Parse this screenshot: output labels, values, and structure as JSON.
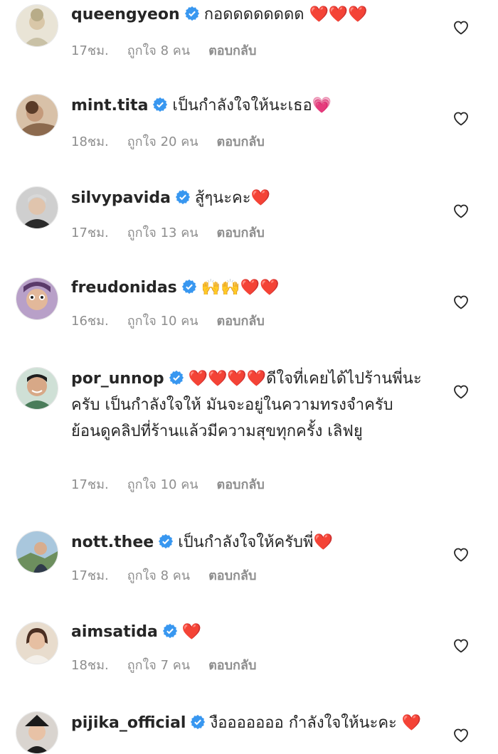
{
  "comments": [
    {
      "username": "queengyeon",
      "text": "กอดดดดดดดด ❤️❤️❤️",
      "time": "17ชม.",
      "likes": "ถูกใจ 8 คน",
      "reply": "ตอบกลับ"
    },
    {
      "username": "mint.tita",
      "text": "เป็นกำลังใจให้นะเธอ💗",
      "time": "18ชม.",
      "likes": "ถูกใจ 20 คน",
      "reply": "ตอบกลับ"
    },
    {
      "username": "silvypavida",
      "text": "สู้ๆนะคะ❤️",
      "time": "17ชม.",
      "likes": "ถูกใจ 13 คน",
      "reply": "ตอบกลับ"
    },
    {
      "username": "freudonidas",
      "text": "🙌🙌❤️❤️",
      "time": "16ชม.",
      "likes": "ถูกใจ 10 คน",
      "reply": "ตอบกลับ"
    },
    {
      "username": "por_unnop",
      "text": "❤️❤️❤️❤️ดีใจที่เคยได้ไปร้านพี่นะครับ เป็นกำลังใจให้ มันจะอยู่ในความทรงจำครับ ย้อนดูคลิปที่ร้านแล้วมีความสุขทุกครั้ง เลิฟยู",
      "time": "17ชม.",
      "likes": "ถูกใจ 10 คน",
      "reply": "ตอบกลับ"
    },
    {
      "username": "nott.thee",
      "text": "เป็นกำลังใจให้ครับพี่❤️",
      "time": "17ชม.",
      "likes": "ถูกใจ 8 คน",
      "reply": "ตอบกลับ"
    },
    {
      "username": "aimsatida",
      "text": "❤️",
      "time": "18ชม.",
      "likes": "ถูกใจ 7 คน",
      "reply": "ตอบกลับ"
    },
    {
      "username": "pijika_official",
      "text": "งือออออออ กำลังใจให้นะคะ ❤️",
      "time": "",
      "likes": "",
      "reply": ""
    }
  ],
  "icons": {
    "verified": "verified-badge-icon",
    "like": "heart-outline-icon"
  },
  "colors": {
    "verified": "#3897f0",
    "muted": "#8e8e8e",
    "text": "#262626",
    "heart": "#e0182d"
  }
}
